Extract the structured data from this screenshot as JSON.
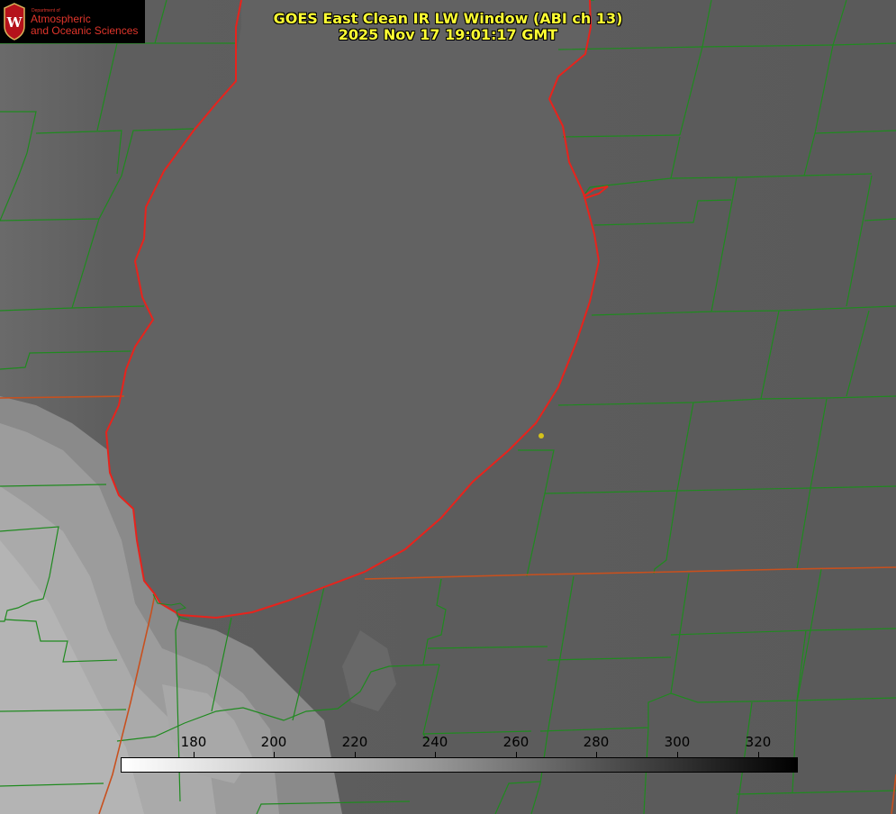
{
  "title": {
    "line1": "GOES East Clean IR LW Window (ABI ch 13)",
    "line2": "2025 Nov 17 19:01:17 GMT"
  },
  "logo": {
    "department": "Department of",
    "line1": "Atmospheric",
    "line2": "and Oceanic Sciences",
    "crest_letter": "W"
  },
  "colorbar": {
    "ticks": [
      "180",
      "200",
      "220",
      "240",
      "260",
      "280",
      "300",
      "320"
    ]
  },
  "colors": {
    "title": "#ffff33",
    "shoreline": "#e8231c",
    "county_lines": "#1f8a1f",
    "state_lines": "#c8501e",
    "marker": "#d4c21a"
  },
  "icons": [
    "uw-crest-icon",
    "station-marker-icon"
  ]
}
